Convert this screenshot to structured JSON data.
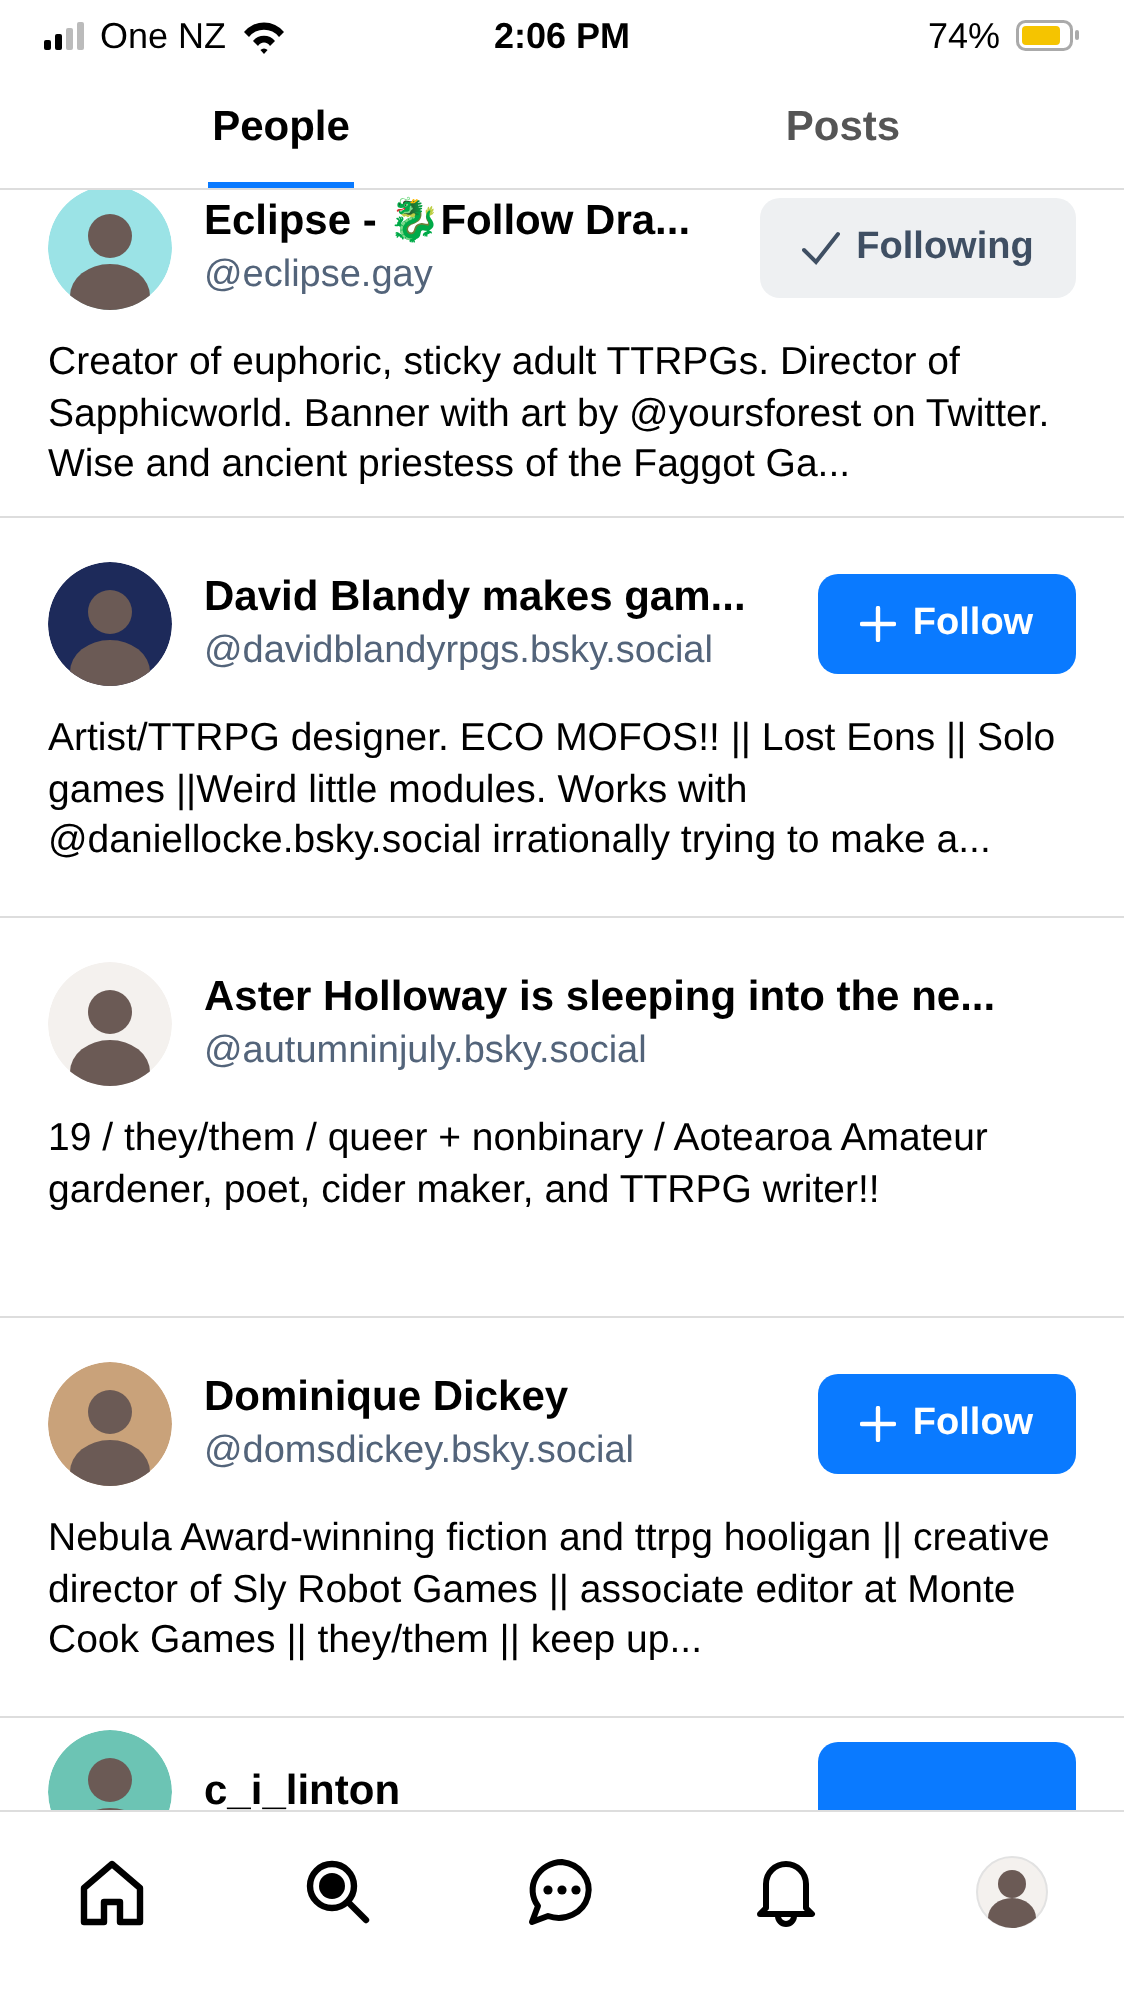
{
  "status_bar": {
    "carrier": "One NZ",
    "time": "2:06 PM",
    "battery": "74%"
  },
  "tabs": [
    {
      "label": "People",
      "selected": true
    },
    {
      "label": "Posts",
      "selected": false
    }
  ],
  "people": [
    {
      "name": "Eclipse - 🐉Follow Dra...",
      "handle": "@eclipse.gay",
      "bio": "Creator of euphoric, sticky adult TTRPGs. Director of Sapphicworld. Banner with art by @yoursforest on Twitter. Wise and ancient priestess of the Faggot Ga...",
      "color": "#9be3e6",
      "button": {
        "kind": "following",
        "label": "Following"
      }
    },
    {
      "name": "David Blandy makes gam...",
      "handle": "@davidblandyrpgs.bsky.social",
      "bio": "Artist/TTRPG designer. ECO MOFOS!! || Lost Eons || Solo games ||Weird little modules. Works with @daniellocke.bsky.social irrationally trying to make a...",
      "color": "#1d2a5a",
      "button": {
        "kind": "follow",
        "label": "Follow"
      }
    },
    {
      "name": "Aster Holloway is sleeping into the ne...",
      "handle": "@autumninjuly.bsky.social",
      "bio": "19 / they/them / queer + nonbinary / Aotearoa Amateur gardener, poet, cider maker, and TTRPG writer!!",
      "color": "#f4f1ee"
    },
    {
      "name": "Dominique Dickey",
      "handle": "@domsdickey.bsky.social",
      "bio": "Nebula Award-winning fiction and ttrpg hooligan || creative director of Sly Robot Games || associate editor at Monte Cook Games || they/them || keep up...",
      "color": "#c9a27a",
      "button": {
        "kind": "follow",
        "label": "Follow"
      }
    },
    {
      "name": "c_i_linton",
      "color": "#6cc4b4",
      "button": {
        "kind": "follow"
      }
    }
  ],
  "nav": [
    {
      "kind": "home"
    },
    {
      "kind": "search"
    },
    {
      "kind": "chat"
    },
    {
      "kind": "bell"
    },
    {
      "kind": "profile"
    }
  ]
}
